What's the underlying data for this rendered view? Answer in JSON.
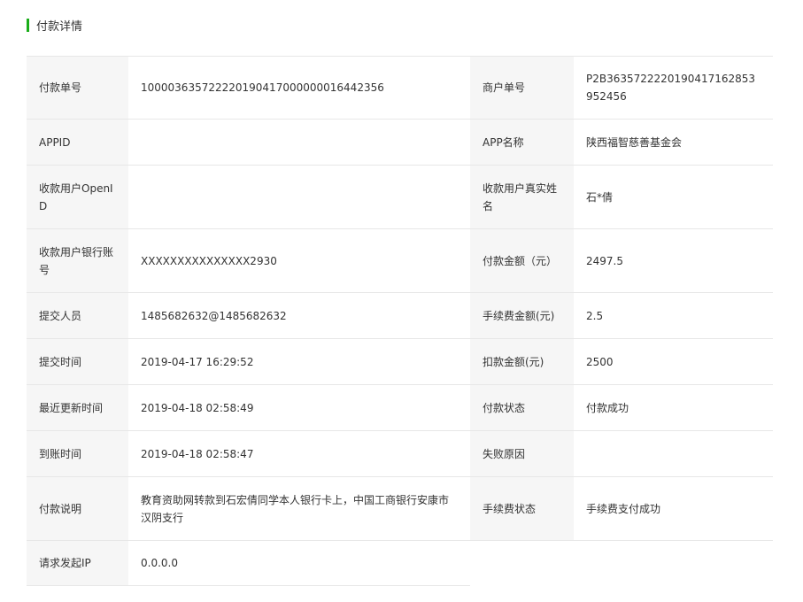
{
  "section_title": "付款详情",
  "rows": [
    {
      "l_label": "付款单号",
      "l_value": "100003635722220190417000000016442356",
      "r_label": "商户单号",
      "r_value": "P2B3635722220190417162853952456"
    },
    {
      "l_label": "APPID",
      "l_value": "",
      "r_label": "APP名称",
      "r_value": "陕西福智慈善基金会"
    },
    {
      "l_label": "收款用户OpenID",
      "l_value": "",
      "r_label": "收款用户真实姓名",
      "r_value": "石*倩"
    },
    {
      "l_label": "收款用户银行账号",
      "l_value": "XXXXXXXXXXXXXXX2930",
      "r_label": "付款金额（元）",
      "r_value": "2497.5"
    },
    {
      "l_label": "提交人员",
      "l_value": "1485682632@1485682632",
      "r_label": "手续费金额(元)",
      "r_value": "2.5"
    },
    {
      "l_label": "提交时间",
      "l_value": "2019-04-17 16:29:52",
      "r_label": "扣款金额(元)",
      "r_value": "2500"
    },
    {
      "l_label": "最近更新时间",
      "l_value": "2019-04-18 02:58:49",
      "r_label": "付款状态",
      "r_value": "付款成功"
    },
    {
      "l_label": "到账时间",
      "l_value": "2019-04-18 02:58:47",
      "r_label": "失败原因",
      "r_value": ""
    },
    {
      "l_label": "付款说明",
      "l_value": "教育资助网转款到石宏倩同学本人银行卡上，中国工商银行安康市汉阴支行",
      "r_label": "手续费状态",
      "r_value": "手续费支付成功"
    },
    {
      "l_label": "请求发起IP",
      "l_value": "0.0.0.0"
    }
  ]
}
